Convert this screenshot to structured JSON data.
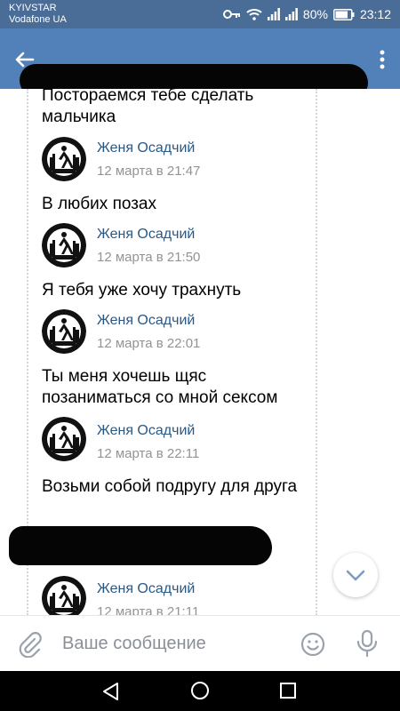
{
  "status_bar": {
    "carrier_primary": "KYIVSTAR",
    "carrier_secondary": "Vodafone UA",
    "battery": "80%",
    "time": "23:12",
    "icons": [
      "key-icon",
      "wifi-icon",
      "signal-icon",
      "signal-icon",
      "battery-icon"
    ]
  },
  "app_bar": {
    "back_icon": "arrow-left-icon",
    "menu_icon": "more-vertical-icon",
    "title_redacted": true
  },
  "chat": {
    "messages": [
      {
        "text": "Постораемся тебе сделать мальчика"
      },
      {
        "author": "Женя Осадчий",
        "time": "12 марта в 21:47",
        "text": "В любих позах"
      },
      {
        "author": "Женя Осадчий",
        "time": "12 марта в 21:50",
        "text": "Я тебя уже хочу трахнуть"
      },
      {
        "author": "Женя Осадчий",
        "time": "12 марта в 22:01",
        "text": "Ты меня хочешь щяс позаниматься со мной сексом"
      },
      {
        "author": "Женя Осадчий",
        "time": "12 марта в 22:11",
        "text": "Возьми собой подругу для друга"
      },
      {
        "author": "Женя Осадчий",
        "time": "12 марта в 21:11"
      }
    ],
    "scroll_button_icon": "chevron-down-icon"
  },
  "composer": {
    "placeholder": "Ваше сообщение",
    "value": "",
    "attach_icon": "paperclip-icon",
    "emoji_icon": "smile-icon",
    "mic_icon": "microphone-icon"
  },
  "nav_bar": {
    "icons": [
      "nav-back-icon",
      "nav-home-icon",
      "nav-recents-icon"
    ]
  },
  "colors": {
    "status_bar": "#4a6d97",
    "app_bar": "#5181b8",
    "author_link": "#2a5885",
    "timestamp": "#939393",
    "text": "#000000"
  }
}
